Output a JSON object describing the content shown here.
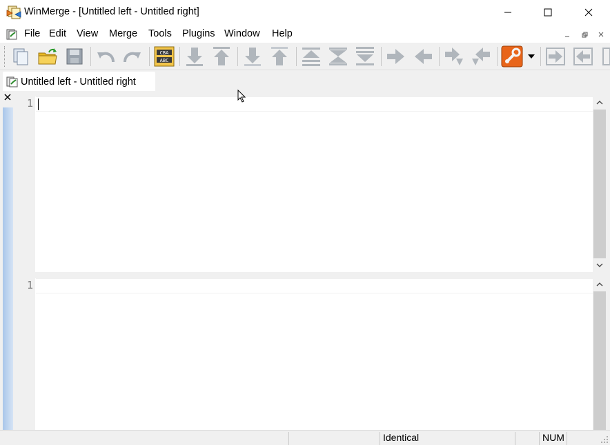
{
  "window": {
    "title": "WinMerge - [Untitled left - Untitled right]"
  },
  "menu": {
    "items": [
      "File",
      "Edit",
      "View",
      "Merge",
      "Tools",
      "Plugins",
      "Window",
      "Help"
    ]
  },
  "toolbar": {
    "buttons": [
      "new-document-icon",
      "open-folder-icon",
      "save-icon",
      "undo-icon",
      "redo-icon",
      "compare-abc-icon",
      "next-diff-icon",
      "prev-diff-icon",
      "next-conflict-icon",
      "prev-conflict-icon",
      "first-diff-icon",
      "current-diff-icon",
      "last-diff-icon",
      "copy-right-icon",
      "copy-left-icon",
      "copy-right-advance-icon",
      "copy-left-advance-icon",
      "options-icon",
      "copy-all-right-icon",
      "copy-all-left-icon"
    ]
  },
  "tab": {
    "label": "Untitled left - Untitled right"
  },
  "editor": {
    "left_line_number": "1",
    "right_line_number": "1"
  },
  "status": {
    "compare_result": "Identical",
    "num_lock": "NUM"
  },
  "colors": {
    "location_bar": "#a9c6ea",
    "scroll_thumb": "#cdcdcd",
    "toolbar_bg": "#f0f0f0"
  }
}
